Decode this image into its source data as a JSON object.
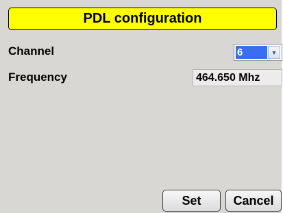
{
  "dialog": {
    "title": "PDL configuration",
    "title_color": "#ffff00",
    "background_color": "#d9d7d3"
  },
  "fields": {
    "channel": {
      "label": "Channel",
      "value": "6",
      "selection_color": "#3a6df0",
      "arrow_icon": "chevron-down-icon"
    },
    "frequency": {
      "label": "Frequency",
      "value": "464.650 Mhz"
    }
  },
  "buttons": {
    "set_label": "Set",
    "cancel_label": "Cancel"
  }
}
